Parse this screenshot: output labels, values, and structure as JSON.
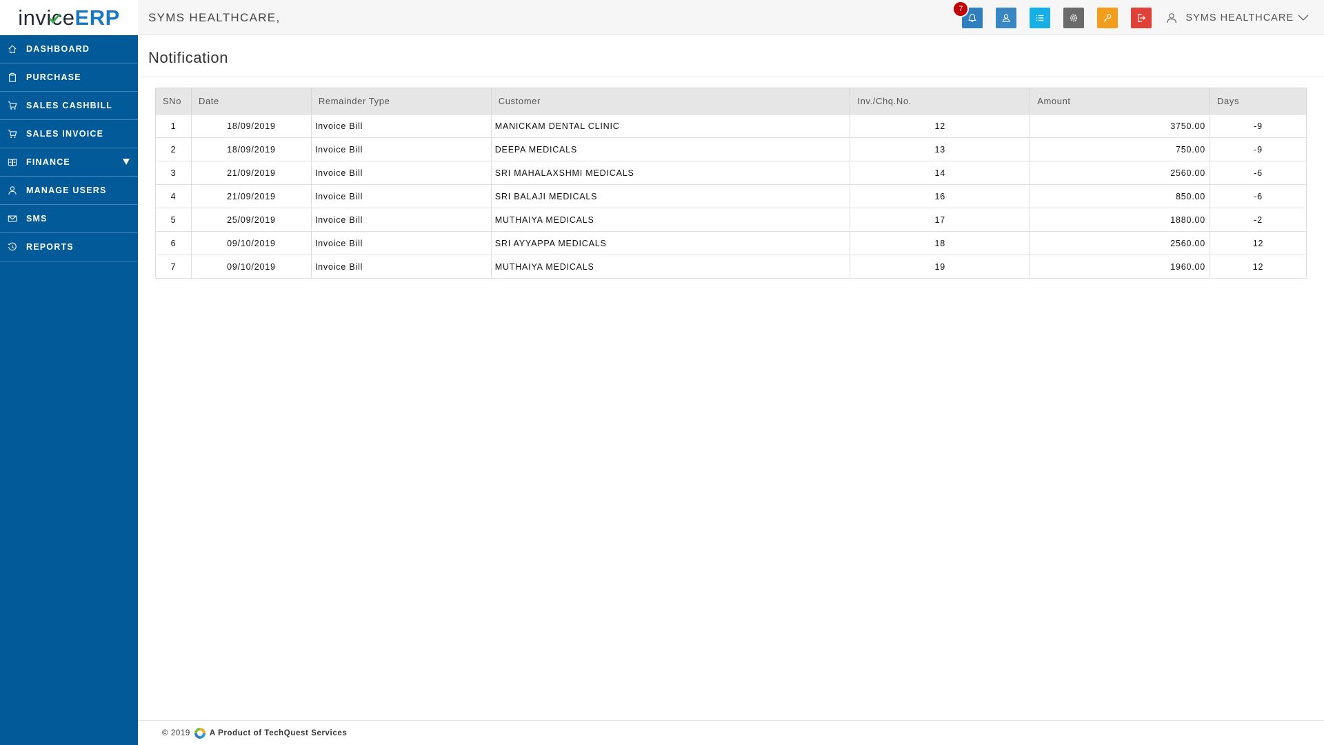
{
  "brand": {
    "part1": "inv",
    "part2": "ice",
    "part3": "ERP",
    "color_dark": "#1f2a36",
    "color_blue": "#1a78c2",
    "check_color": "#3fae49"
  },
  "company_name": "SYMS HEALTHCARE,",
  "toolbar": {
    "notification_count": "7",
    "buttons": [
      {
        "name": "notifications",
        "icon": "bell-icon",
        "color": "#2f7fbf"
      },
      {
        "name": "profile",
        "icon": "user-icon",
        "color": "#3a86c2"
      },
      {
        "name": "list",
        "icon": "list-icon",
        "color": "#17b0e6"
      },
      {
        "name": "settings",
        "icon": "gear-icon",
        "color": "#6a6a6a"
      },
      {
        "name": "key",
        "icon": "key-icon",
        "color": "#f29d1c"
      },
      {
        "name": "logout",
        "icon": "logout-icon",
        "color": "#e0423a"
      }
    ],
    "user_name": "SYMS HEALTHCARE"
  },
  "sidebar": {
    "bg": "#035a98",
    "items": [
      {
        "label": "DASHBOARD",
        "icon": "home-icon"
      },
      {
        "label": "PURCHASE",
        "icon": "clipboard-icon"
      },
      {
        "label": "SALES CASHBILL",
        "icon": "cart-icon"
      },
      {
        "label": "SALES INVOICE",
        "icon": "cart-icon"
      },
      {
        "label": "FINANCE",
        "icon": "ledger-icon",
        "has_submenu": true
      },
      {
        "label": "MANAGE USERS",
        "icon": "user-icon"
      },
      {
        "label": "SMS",
        "icon": "envelope-icon"
      },
      {
        "label": "REPORTS",
        "icon": "history-icon"
      }
    ]
  },
  "page": {
    "title": "Notification"
  },
  "table": {
    "headers": [
      "SNo",
      "Date",
      "Remainder Type",
      "Customer",
      "Inv./Chq.No.",
      "Amount",
      "Days"
    ],
    "rows": [
      {
        "sno": "1",
        "date": "18/09/2019",
        "type": "Invoice Bill",
        "customer": "MANICKAM DENTAL CLINIC",
        "inv": "12",
        "amount": "3750.00",
        "days": "-9"
      },
      {
        "sno": "2",
        "date": "18/09/2019",
        "type": "Invoice Bill",
        "customer": "DEEPA MEDICALS",
        "inv": "13",
        "amount": "750.00",
        "days": "-9"
      },
      {
        "sno": "3",
        "date": "21/09/2019",
        "type": "Invoice Bill",
        "customer": "SRI MAHALAXSHMI MEDICALS",
        "inv": "14",
        "amount": "2560.00",
        "days": "-6"
      },
      {
        "sno": "4",
        "date": "21/09/2019",
        "type": "Invoice Bill",
        "customer": "SRI BALAJI MEDICALS",
        "inv": "16",
        "amount": "850.00",
        "days": "-6"
      },
      {
        "sno": "5",
        "date": "25/09/2019",
        "type": "Invoice Bill",
        "customer": "MUTHAIYA MEDICALS",
        "inv": "17",
        "amount": "1880.00",
        "days": "-2"
      },
      {
        "sno": "6",
        "date": "09/10/2019",
        "type": "Invoice Bill",
        "customer": "SRI AYYAPPA MEDICALS",
        "inv": "18",
        "amount": "2560.00",
        "days": "12"
      },
      {
        "sno": "7",
        "date": "09/10/2019",
        "type": "Invoice Bill",
        "customer": "MUTHAIYA MEDICALS",
        "inv": "19",
        "amount": "1960.00",
        "days": "12"
      }
    ]
  },
  "footer": {
    "copyright": "© 2019",
    "product": "A Product of TechQuest Services"
  }
}
